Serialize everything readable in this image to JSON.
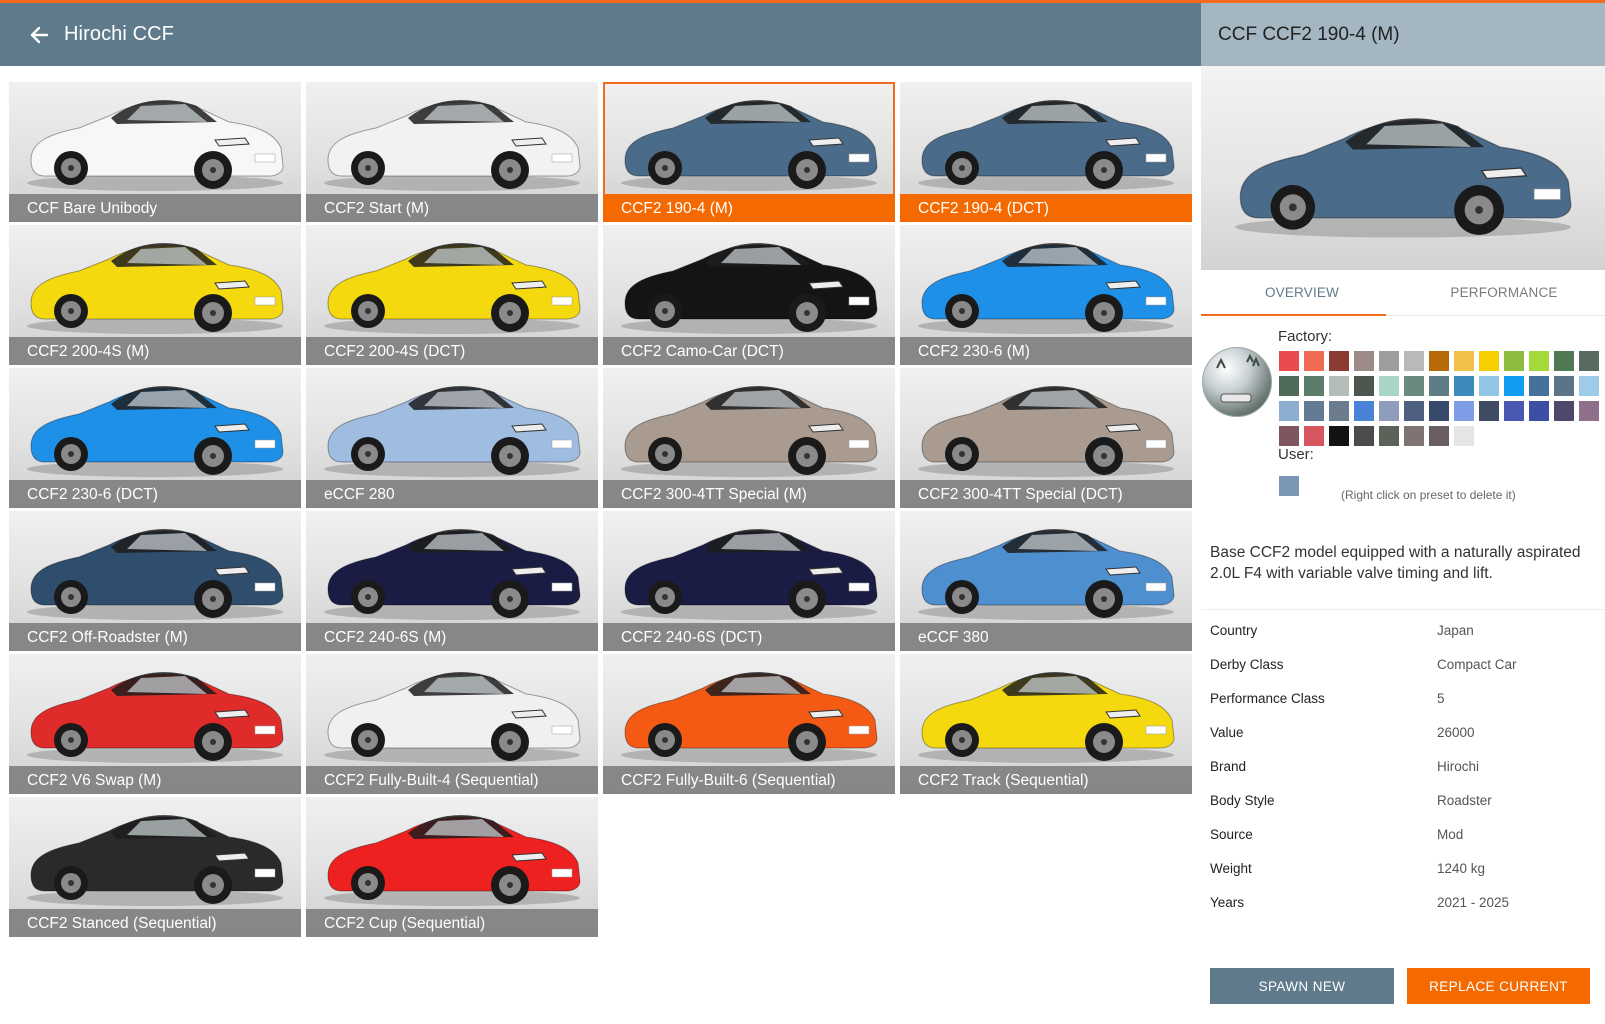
{
  "header": {
    "title": "Hirochi CCF",
    "back_icon": "arrow-left-icon"
  },
  "grid": {
    "tiles": [
      {
        "label": "CCF Bare Unibody",
        "color": "#ffffff",
        "state": "normal",
        "variant": "bare"
      },
      {
        "label": "CCF2 Start (M)",
        "color": "#f2f2f2",
        "state": "normal"
      },
      {
        "label": "CCF2 190-4 (M)",
        "color": "#4a6c8a",
        "state": "selected"
      },
      {
        "label": "CCF2 190-4 (DCT)",
        "color": "#4a6c8a",
        "state": "highlight"
      },
      {
        "label": "CCF2 200-4S (M)",
        "color": "#f5d90f",
        "state": "normal"
      },
      {
        "label": "CCF2 200-4S (DCT)",
        "color": "#f5d90f",
        "state": "normal"
      },
      {
        "label": "CCF2 Camo-Car (DCT)",
        "color": "#141414",
        "state": "normal"
      },
      {
        "label": "CCF2 230-6 (M)",
        "color": "#1f90e8",
        "state": "normal"
      },
      {
        "label": "CCF2 230-6 (DCT)",
        "color": "#1f90e8",
        "state": "normal"
      },
      {
        "label": "eCCF 280",
        "color": "#9fbde0",
        "state": "normal"
      },
      {
        "label": "CCF2 300-4TT Special (M)",
        "color": "#a99b8f",
        "state": "normal"
      },
      {
        "label": "CCF2 300-4TT Special (DCT)",
        "color": "#a99b8f",
        "state": "normal"
      },
      {
        "label": "CCF2 Off-Roadster (M)",
        "color": "#2f4d6d",
        "state": "normal"
      },
      {
        "label": "CCF2 240-6S (M)",
        "color": "#1a1c44",
        "state": "normal"
      },
      {
        "label": "CCF2 240-6S (DCT)",
        "color": "#1a1c44",
        "state": "normal"
      },
      {
        "label": "eCCF 380",
        "color": "#4e8fd0",
        "state": "normal"
      },
      {
        "label": "CCF2 V6 Swap (M)",
        "color": "#e02b2b",
        "state": "normal"
      },
      {
        "label": "CCF2 Fully-Built-4 (Sequential)",
        "color": "#f0f0f0",
        "state": "normal"
      },
      {
        "label": "CCF2 Fully-Built-6 (Sequential)",
        "color": "#f45a14",
        "state": "normal"
      },
      {
        "label": "CCF2 Track (Sequential)",
        "color": "#f5d90f",
        "state": "normal"
      },
      {
        "label": "CCF2 Stanced (Sequential)",
        "color": "#2a2a2a",
        "state": "normal"
      },
      {
        "label": "CCF2 Cup (Sequential)",
        "color": "#ef2020",
        "state": "normal"
      }
    ]
  },
  "detail": {
    "title": "CCF CCF2 190-4 (M)",
    "preview_color": "#4a6c8a",
    "tabs": {
      "overview": "OVERVIEW",
      "performance": "PERFORMANCE"
    },
    "paint": {
      "factory_label": "Factory:",
      "user_label": "User:",
      "hint": "(Right click on preset to delete it)",
      "factory_colors": [
        "#e84c4c",
        "#f06a54",
        "#8c3b32",
        "#9c8a86",
        "#9e9e9e",
        "#b9b9b9",
        "#b96a08",
        "#f2c14a",
        "#f5cf00",
        "#8dbb3c",
        "#a4d93b",
        "#4f7a55",
        "#576b5e",
        "#506b5a",
        "#5c7d69",
        "#b5bdb9",
        "#4d5750",
        "#a7d6c4",
        "#6a8a80",
        "#5e7d85",
        "#3d8bbd",
        "#93c6e4",
        "#129df0",
        "#44729a",
        "#5c7488",
        "#9ecbe9",
        "#8eaed1",
        "#637a94",
        "#6b7c8f",
        "#4a82d7",
        "#8d9dbb",
        "#4e5f80",
        "#384a6b",
        "#7f9de6",
        "#3f4a63",
        "#4a58b0",
        "#3d4fa5",
        "#50486a",
        "#8f6f8a",
        "#7f5560",
        "#d6575f",
        "#121212",
        "#4a4c4e",
        "#5b6258",
        "#7f7472",
        "#6b5e63",
        "#e5e5e5"
      ],
      "user_colors": [
        "#7b95b4"
      ]
    },
    "description": "Base CCF2 model equipped with a naturally aspirated 2.0L F4 with variable valve timing and lift.",
    "info": [
      {
        "key": "Country",
        "value": "Japan"
      },
      {
        "key": "Derby Class",
        "value": "Compact Car"
      },
      {
        "key": "Performance Class",
        "value": "5"
      },
      {
        "key": "Value",
        "value": "26000"
      },
      {
        "key": "Brand",
        "value": "Hirochi"
      },
      {
        "key": "Body Style",
        "value": "Roadster"
      },
      {
        "key": "Source",
        "value": "Mod"
      },
      {
        "key": "Weight",
        "value": "1240 kg"
      },
      {
        "key": "Years",
        "value": "2021 - 2025"
      }
    ],
    "buttons": {
      "spawn": "SPAWN NEW",
      "replace": "REPLACE CURRENT"
    }
  }
}
